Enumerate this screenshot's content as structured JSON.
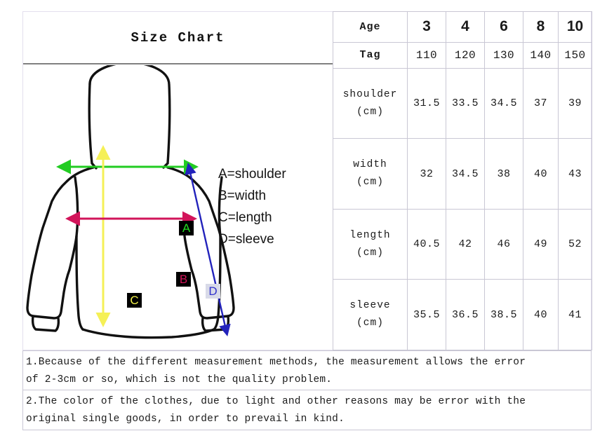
{
  "frame": {
    "title": "Size Chart"
  },
  "diagram": {
    "alt": "hoodie-sweatshirt-outline",
    "markers": [
      {
        "key": "A",
        "label": "A",
        "measure": "shoulder",
        "text_color": "#22dd22",
        "box_color": "#000000"
      },
      {
        "key": "B",
        "label": "B",
        "measure": "width",
        "text_color": "#d2145a",
        "box_color": "#000000"
      },
      {
        "key": "C",
        "label": "C",
        "measure": "length",
        "text_color": "#f2f24a",
        "box_color": "#000000"
      },
      {
        "key": "D",
        "label": "D",
        "measure": "sleeve",
        "text_color": "#3333cc",
        "box_color": "#d8dae8"
      }
    ],
    "legend": [
      "A=shoulder",
      "B=width",
      "C=length",
      "D=sleeve"
    ],
    "arrow_colors": {
      "shoulder": "#22cc22",
      "width": "#d2145a",
      "length": "#f5f056",
      "sleeve": "#2222bb",
      "outline": "#111111"
    }
  },
  "chart_data": {
    "type": "table",
    "title": "Size Chart",
    "header_label": "Age",
    "tag_label": "Tag",
    "categories": [
      "3",
      "4",
      "6",
      "8",
      "10"
    ],
    "tags": [
      "110",
      "120",
      "130",
      "140",
      "150"
    ],
    "rows": [
      {
        "label": "shoulder",
        "unit": "(cm)",
        "values": [
          "31.5",
          "33.5",
          "34.5",
          "37",
          "39"
        ]
      },
      {
        "label": "width",
        "unit": "(cm)",
        "values": [
          "32",
          "34.5",
          "38",
          "40",
          "43"
        ]
      },
      {
        "label": "length",
        "unit": "(cm)",
        "values": [
          "40.5",
          "42",
          "46",
          "49",
          "52"
        ]
      },
      {
        "label": "sleeve",
        "unit": "(cm)",
        "values": [
          "35.5",
          "36.5",
          "38.5",
          "40",
          "41"
        ]
      }
    ]
  },
  "notes": [
    {
      "line1": "1.Because of the different measurement methods, the measurement allows the error",
      "line2": "of 2-3cm or so, which is not the quality problem."
    },
    {
      "line1": "2.The color of the clothes, due to light and other reasons may be error with the",
      "line2": "original single goods, in order to prevail in kind."
    }
  ]
}
